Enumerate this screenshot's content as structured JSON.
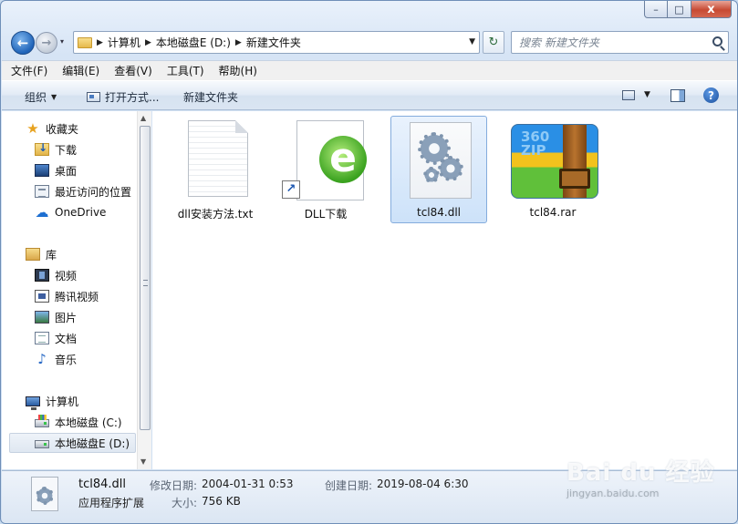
{
  "window": {
    "controls": {
      "minimize": "–",
      "maximize": "□",
      "close": "x"
    }
  },
  "nav": {
    "back": "←",
    "forward": "→",
    "history": "▾",
    "breadcrumbs": [
      "计算机",
      "本地磁盘E (D:)",
      "新建文件夹"
    ],
    "refresh": "↻",
    "search_placeholder": "搜索 新建文件夹"
  },
  "menu": [
    "文件(F)",
    "编辑(E)",
    "查看(V)",
    "工具(T)",
    "帮助(H)"
  ],
  "toolbar": {
    "organize": "组织",
    "open_with": "打开方式...",
    "new_folder": "新建文件夹",
    "help": "?"
  },
  "sidebar": {
    "favorites_header": "收藏夹",
    "favorites": [
      "下载",
      "桌面",
      "最近访问的位置",
      "OneDrive"
    ],
    "library_header": "库",
    "libraries": [
      "视频",
      "腾讯视频",
      "图片",
      "文档",
      "音乐"
    ],
    "computer_header": "计算机",
    "drives": [
      "本地磁盘 (C:)",
      "本地磁盘E (D:)"
    ],
    "selected": "本地磁盘E (D:)"
  },
  "files": [
    {
      "name": "dll安装方法.txt",
      "icon": "text-file-icon"
    },
    {
      "name": "DLL下载",
      "icon": "browser-shortcut-icon",
      "icon_letter": "e",
      "shortcut_arrow": "↗"
    },
    {
      "name": "tcl84.dll",
      "icon": "dll-gear-icon",
      "selected": true
    },
    {
      "name": "tcl84.rar",
      "icon": "archive-icon",
      "icon_text": "360\nZIP"
    }
  ],
  "details": {
    "file_name": "tcl84.dll",
    "file_type": "应用程序扩展",
    "modified_label": "修改日期:",
    "modified_value": "2004-01-31 0:53",
    "size_label": "大小:",
    "size_value": "756 KB",
    "created_label": "创建日期:",
    "created_value": "2019-08-04 6:30"
  },
  "watermark": {
    "logo": "Bai du 经验",
    "url": "jingyan.baidu.com"
  },
  "colors": {
    "accent": "#84acdd",
    "frame": "#cfdff2",
    "close": "#c74a33"
  }
}
